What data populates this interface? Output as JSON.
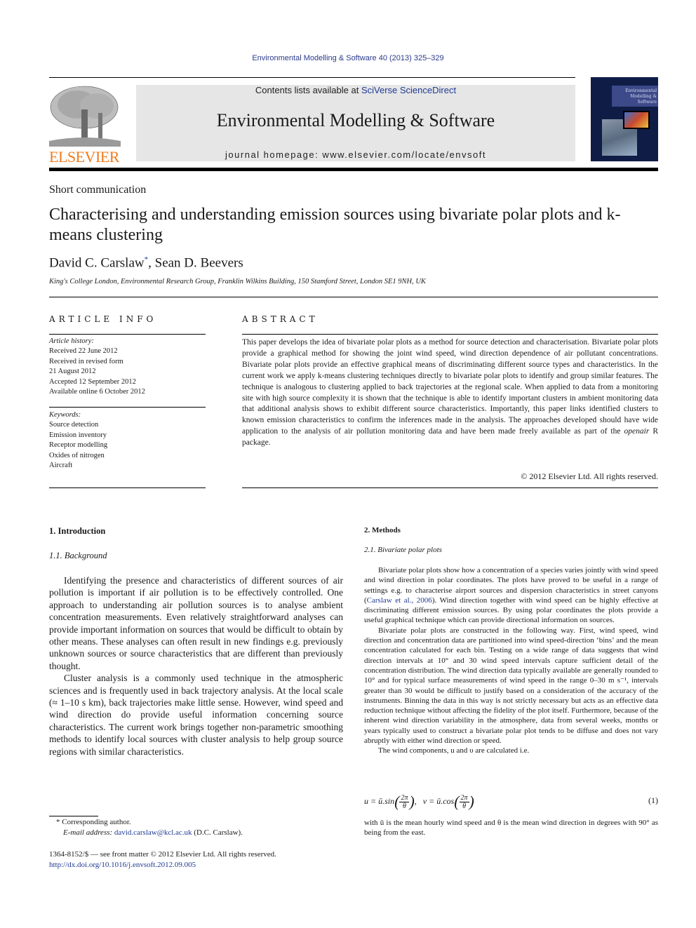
{
  "header": {
    "journal_ref": "Environmental Modelling & Software 40 (2013) 325–329",
    "contents_prefix": "Contents lists available at ",
    "contents_link": "SciVerse ScienceDirect",
    "journal_title": "Environmental Modelling & Software",
    "homepage": "journal homepage: www.elsevier.com/locate/envsoft",
    "publisher_logo_text": "ELSEVIER",
    "cover_title": "Environmental Modelling & Software",
    "colors": {
      "publisher_orange": "#f07b1d",
      "link_blue": "#1f3a93",
      "banner_gray": "#e6e6e6",
      "cover_navy": "#0f1c46"
    }
  },
  "article": {
    "type": "Short communication",
    "title": "Characterising and understanding emission sources using bivariate polar plots and k-means clustering",
    "author1": "David C. Carslaw",
    "author1_mark": "*",
    "author_sep": ", ",
    "author2": "Sean D. Beevers",
    "affiliation": "King's College London, Environmental Research Group, Franklin Wilkins Building, 150 Stamford Street, London SE1 9NH, UK"
  },
  "article_info": {
    "heading": "ARTICLE INFO",
    "history_label": "Article history:",
    "history": [
      "Received 22 June 2012",
      "Received in revised form",
      "21 August 2012",
      "Accepted 12 September 2012",
      "Available online 6 October 2012"
    ],
    "keywords_label": "Keywords:",
    "keywords": [
      "Source detection",
      "Emission inventory",
      "Receptor modelling",
      "Oxides of nitrogen",
      "Aircraft"
    ]
  },
  "abstract": {
    "heading": "ABSTRACT",
    "text_part1": "This paper develops the idea of bivariate polar plots as a method for source detection and character­isation. Bivariate polar plots provide a graphical method for showing the joint wind speed, wind direction dependence of air pollutant concentrations. Bivariate polar plots provide an effective graphical means of discriminating different source types and characteristics. In the current work we apply k-means clustering techniques directly to bivariate polar plots to identify and group similar features. The tech­nique is analogous to clustering applied to back trajectories at the regional scale. When applied to data from a monitoring site with high source complexity it is shown that the technique is able to identify important clusters in ambient monitoring data that additional analysis shows to exhibit different source characteristics. Importantly, this paper links identified clusters to known emission characteristics to confirm the inferences made in the analysis. The approaches developed should have wide application to the analysis of air pollution monitoring data and have been made freely available as part of the ",
    "text_italic": "openair",
    "text_part2": " R package.",
    "copyright": "© 2012 Elsevier Ltd. All rights reserved."
  },
  "introduction": {
    "heading": "1.  Introduction",
    "subheading": "1.1.  Background",
    "paragraphs": [
      "Identifying the presence and characteristics of different sources of air pollution is important if air pollution is to be effectively controlled. One approach to understanding air pollution sources is to analyse ambient concentration measurements. Even relatively straightforward analyses can provide important information on sources that would be difficult to obtain by other means. These analyses can often result in new findings e.g. previously unknown sources or source characteristics that are different than previously thought.",
      "Cluster analysis is a commonly used technique in the atmo­spheric sciences and is frequently used in back trajectory analysis. At the local scale (≈ 1–10 s km), back trajectories make little sense. However, wind speed and wind direction do provide useful infor­mation concerning source characteristics. The current work brings together non-parametric smoothing methods to identify local sources with cluster analysis to help group source regions with similar characteristics."
    ]
  },
  "footnote": {
    "mark_text": "* Corresponding author.",
    "email_label": "E-mail address: ",
    "email": "david.carslaw@kcl.ac.uk",
    "email_suffix": " (D.C. Carslaw)."
  },
  "front_matter": {
    "issn_line": "1364-8152/$ — see front matter © 2012 Elsevier Ltd. All rights reserved.",
    "doi": "http://dx.doi.org/10.1016/j.envsoft.2012.09.005"
  },
  "methods": {
    "heading": "2.  Methods",
    "subheading": "2.1.  Bivariate polar plots",
    "p1_before": "Bivariate polar plots show how a concentration of a species varies jointly with wind speed and wind direction in polar coordinates. The plots have proved to be useful in a range of settings e.g. to characterise airport sources and dispersion characteristics in street canyons (",
    "p1_cite": "Carslaw et al., 2006",
    "p1_after": "). Wind direction together with wind speed can be highly effective at discriminating different emission sources. By using polar coordinates the plots provide a useful graphical technique which can provide directional information on sources.",
    "p2": "Bivariate polar plots are constructed in the following way. First, wind speed, wind direction and concentration data are partitioned into wind speed-direction ‘bins’ and the mean concentration calculated for each bin. Testing on a wide range of data suggests that wind direction intervals at 10° and 30 wind speed intervals capture sufficient detail of the concentration distribution. The wind direction data typically available are generally rounded to 10° and for typical surface measure­ments of wind speed in the range 0–30 m s⁻¹, intervals greater than 30 would be difficult to justify based on a consideration of the accuracy of the instruments. Binning the data in this way is not strictly necessary but acts as an effective data reduction technique without affecting the fidelity of the plot itself. Furthermore, because of the inherent wind direction variability in the atmosphere, data from several weeks, months or years typically used to construct a bivariate polar plot tends to be diffuse and does not vary abruptly with either wind direction or speed.",
    "p3": "The wind components, u and υ are calculated i.e.",
    "equation": {
      "u_lhs": "u = ū.sin",
      "v_lhs": "ν = ū.cos",
      "frac_num": "2π",
      "frac_den": "θ",
      "number": "(1)"
    },
    "after_equation": "with ū is the mean hourly wind speed and θ is the mean wind direction in degrees with 90° as being from the east."
  }
}
